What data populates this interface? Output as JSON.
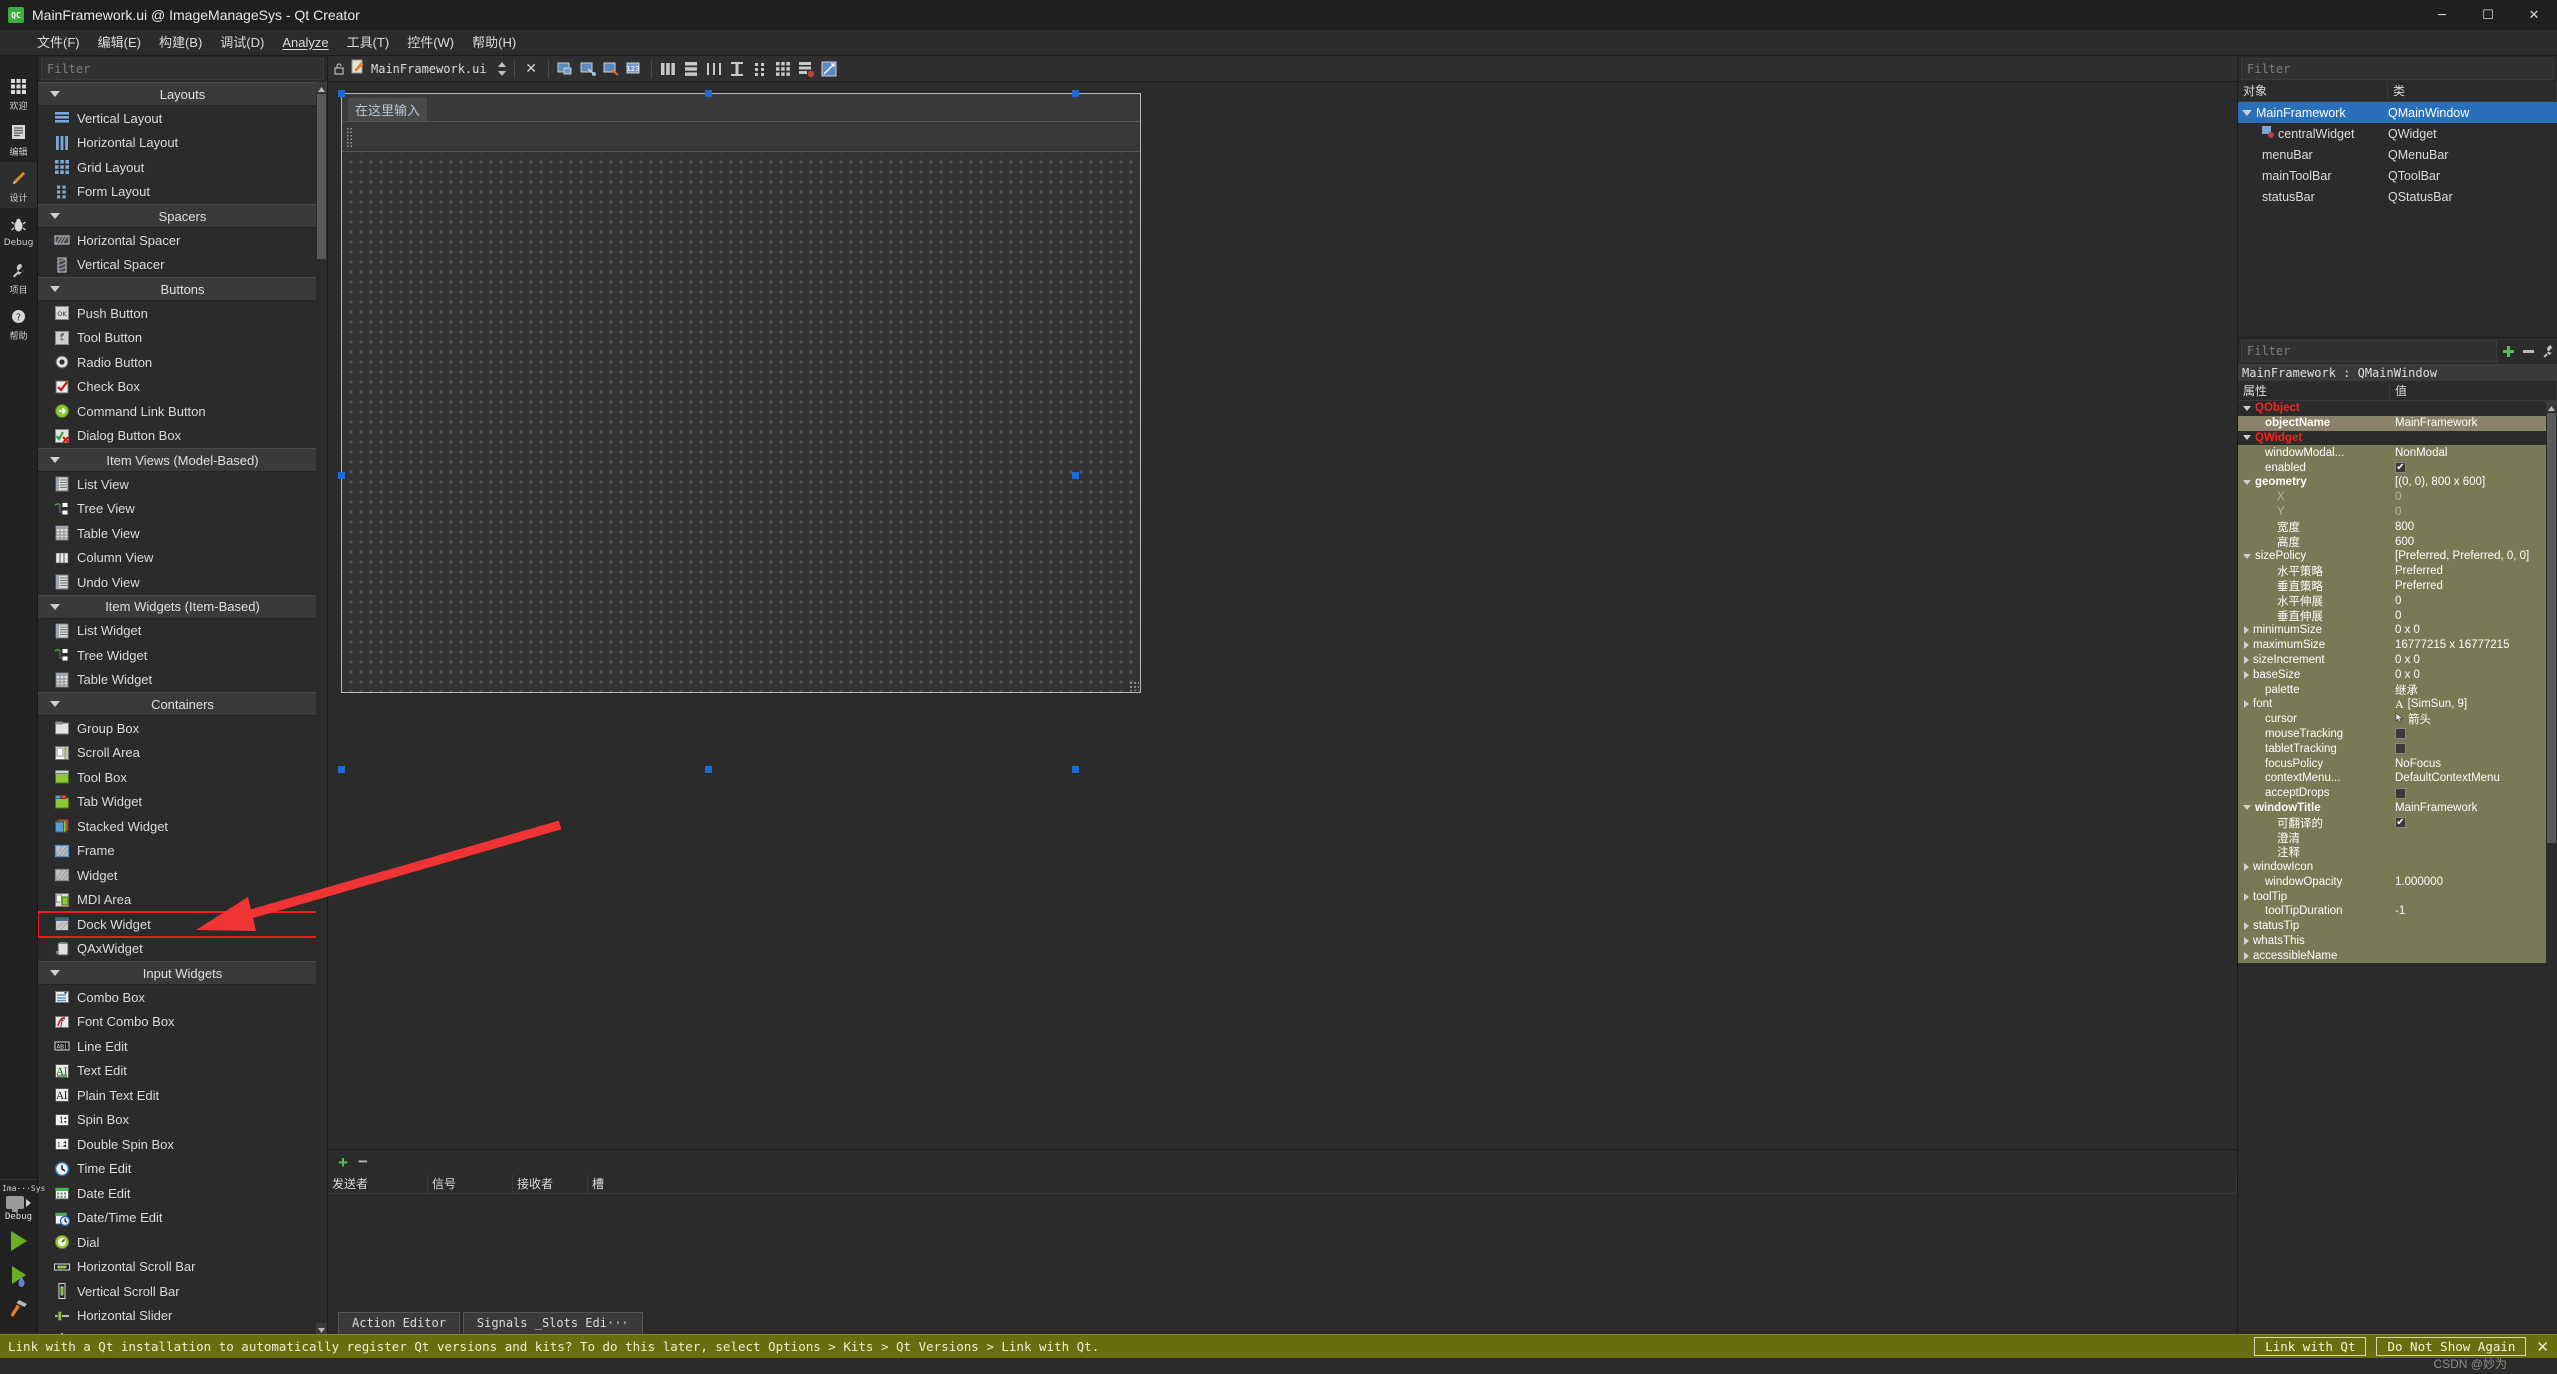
{
  "window": {
    "title": "MainFramework.ui @ ImageManageSys - Qt Creator",
    "app_icon": "QC",
    "minimize": "─",
    "maximize": "☐",
    "close": "✕"
  },
  "menubar": {
    "items": [
      {
        "label": "文件(F)",
        "name": "menu-file"
      },
      {
        "label": "编辑(E)",
        "name": "menu-edit"
      },
      {
        "label": "构建(B)",
        "name": "menu-build"
      },
      {
        "label": "调试(D)",
        "name": "menu-debug"
      },
      {
        "label": "Analyze",
        "name": "menu-analyze"
      },
      {
        "label": "工具(T)",
        "name": "menu-tools"
      },
      {
        "label": "控件(W)",
        "name": "menu-widget"
      },
      {
        "label": "帮助(H)",
        "name": "menu-help"
      }
    ]
  },
  "modebar": {
    "modes": [
      {
        "label": "欢迎",
        "icon": "grid-icon",
        "glyph": "▒",
        "active": false
      },
      {
        "label": "编辑",
        "icon": "document-icon",
        "glyph": "☰",
        "active": false
      },
      {
        "label": "设计",
        "icon": "pencil-icon",
        "glyph": "╱",
        "active": true
      },
      {
        "label": "Debug",
        "icon": "bug-icon",
        "glyph": "✱",
        "active": false
      },
      {
        "label": "项目",
        "icon": "wrench-icon",
        "glyph": "⚒",
        "active": false
      },
      {
        "label": "帮助",
        "icon": "question-icon",
        "glyph": "?",
        "active": false
      }
    ],
    "kit_name": "Ima···Sys",
    "kit_mode": "Debug",
    "run_label": "run",
    "debug_label": "debug",
    "build_label": "build"
  },
  "widgetbox": {
    "filter_placeholder": "Filter",
    "groups": [
      {
        "title": "Layouts",
        "items": [
          {
            "label": "Vertical Layout",
            "icon": "vertical-layout-icon"
          },
          {
            "label": "Horizontal Layout",
            "icon": "horizontal-layout-icon"
          },
          {
            "label": "Grid Layout",
            "icon": "grid-layout-icon"
          },
          {
            "label": "Form Layout",
            "icon": "form-layout-icon"
          }
        ]
      },
      {
        "title": "Spacers",
        "items": [
          {
            "label": "Horizontal Spacer",
            "icon": "horizontal-spacer-icon"
          },
          {
            "label": "Vertical Spacer",
            "icon": "vertical-spacer-icon"
          }
        ]
      },
      {
        "title": "Buttons",
        "items": [
          {
            "label": "Push Button",
            "icon": "push-button-icon"
          },
          {
            "label": "Tool Button",
            "icon": "tool-button-icon"
          },
          {
            "label": "Radio Button",
            "icon": "radio-button-icon"
          },
          {
            "label": "Check Box",
            "icon": "check-box-icon"
          },
          {
            "label": "Command Link Button",
            "icon": "command-link-icon"
          },
          {
            "label": "Dialog Button Box",
            "icon": "dialog-button-box-icon"
          }
        ]
      },
      {
        "title": "Item Views (Model-Based)",
        "items": [
          {
            "label": "List View",
            "icon": "list-view-icon"
          },
          {
            "label": "Tree View",
            "icon": "tree-view-icon"
          },
          {
            "label": "Table View",
            "icon": "table-view-icon"
          },
          {
            "label": "Column View",
            "icon": "column-view-icon"
          },
          {
            "label": "Undo View",
            "icon": "undo-view-icon"
          }
        ]
      },
      {
        "title": "Item Widgets (Item-Based)",
        "items": [
          {
            "label": "List Widget",
            "icon": "list-widget-icon"
          },
          {
            "label": "Tree Widget",
            "icon": "tree-widget-icon"
          },
          {
            "label": "Table Widget",
            "icon": "table-widget-icon"
          }
        ]
      },
      {
        "title": "Containers",
        "items": [
          {
            "label": "Group Box",
            "icon": "group-box-icon"
          },
          {
            "label": "Scroll Area",
            "icon": "scroll-area-icon"
          },
          {
            "label": "Tool Box",
            "icon": "tool-box-icon"
          },
          {
            "label": "Tab Widget",
            "icon": "tab-widget-icon"
          },
          {
            "label": "Stacked Widget",
            "icon": "stacked-widget-icon"
          },
          {
            "label": "Frame",
            "icon": "frame-icon"
          },
          {
            "label": "Widget",
            "icon": "widget-icon"
          },
          {
            "label": "MDI Area",
            "icon": "mdi-area-icon"
          },
          {
            "label": "Dock Widget",
            "icon": "dock-widget-icon",
            "highlight": true
          },
          {
            "label": "QAxWidget",
            "icon": "qax-widget-icon"
          }
        ]
      },
      {
        "title": "Input Widgets",
        "items": [
          {
            "label": "Combo Box",
            "icon": "combo-box-icon"
          },
          {
            "label": "Font Combo Box",
            "icon": "font-combo-box-icon"
          },
          {
            "label": "Line Edit",
            "icon": "line-edit-icon"
          },
          {
            "label": "Text Edit",
            "icon": "text-edit-icon"
          },
          {
            "label": "Plain Text Edit",
            "icon": "plain-text-edit-icon"
          },
          {
            "label": "Spin Box",
            "icon": "spin-box-icon"
          },
          {
            "label": "Double Spin Box",
            "icon": "double-spin-box-icon"
          },
          {
            "label": "Time Edit",
            "icon": "time-edit-icon"
          },
          {
            "label": "Date Edit",
            "icon": "date-edit-icon"
          },
          {
            "label": "Date/Time Edit",
            "icon": "date-time-edit-icon"
          },
          {
            "label": "Dial",
            "icon": "dial-icon"
          },
          {
            "label": "Horizontal Scroll Bar",
            "icon": "horizontal-scroll-bar-icon"
          },
          {
            "label": "Vertical Scroll Bar",
            "icon": "vertical-scroll-bar-icon"
          },
          {
            "label": "Horizontal Slider",
            "icon": "horizontal-slider-icon"
          },
          {
            "label": "Vertical Slider",
            "icon": "vertical-slider-icon"
          }
        ]
      }
    ],
    "highlight_color": "#ee1c1c",
    "annotation_arrow_color": "#f03434"
  },
  "form_toolbar": {
    "filename": "MainFramework.ui",
    "lock_icon": "lock-icon",
    "file_icon": "ui-file-icon",
    "close_icon": "close-icon",
    "buttons": [
      {
        "name": "edit-widgets-button",
        "icon": "edit-widgets-icon"
      },
      {
        "name": "edit-signals-slots-button",
        "icon": "signals-slots-icon"
      },
      {
        "name": "edit-buddies-button",
        "icon": "buddies-icon"
      },
      {
        "name": "edit-tab-order-button",
        "icon": "tab-order-icon"
      },
      {
        "name": "layout-horizontally-button",
        "icon": "layout-horizontal-icon"
      },
      {
        "name": "layout-vertically-button",
        "icon": "layout-vertical-icon"
      },
      {
        "name": "layout-splitter-horizontal-button",
        "icon": "splitter-horizontal-icon"
      },
      {
        "name": "layout-splitter-vertical-button",
        "icon": "splitter-vertical-icon"
      },
      {
        "name": "layout-form-button",
        "icon": "layout-form-icon"
      },
      {
        "name": "layout-grid-button",
        "icon": "layout-grid-icon"
      },
      {
        "name": "break-layout-button",
        "icon": "break-layout-icon"
      },
      {
        "name": "adjust-size-button",
        "icon": "adjust-size-icon"
      }
    ]
  },
  "canvas": {
    "menu_hint": "在这里输入",
    "form_width": 800,
    "form_height": 600
  },
  "bottom_pane": {
    "add_label": "+",
    "remove_label": "−",
    "columns": [
      "发送者",
      "信号",
      "接收者",
      "槽"
    ],
    "rows": [],
    "tabs": [
      {
        "label": "Action Editor",
        "active": false
      },
      {
        "label": "Signals _Slots Edi···",
        "active": true
      }
    ]
  },
  "object_inspector": {
    "filter_placeholder": "Filter",
    "columns": [
      "对象",
      "类"
    ],
    "rows": [
      {
        "name": "MainFramework",
        "class": "QMainWindow",
        "indent": 0,
        "selected": true,
        "expander": true,
        "icon": ""
      },
      {
        "name": "centralWidget",
        "class": "QWidget",
        "indent": 1,
        "selected": false,
        "expander": false,
        "icon": "central-widget-icon"
      },
      {
        "name": "menuBar",
        "class": "QMenuBar",
        "indent": 1,
        "selected": false,
        "expander": false,
        "icon": ""
      },
      {
        "name": "mainToolBar",
        "class": "QToolBar",
        "indent": 1,
        "selected": false,
        "expander": false,
        "icon": ""
      },
      {
        "name": "statusBar",
        "class": "QStatusBar",
        "indent": 1,
        "selected": false,
        "expander": false,
        "icon": ""
      }
    ],
    "selection_color": "#2a6fbb"
  },
  "property_editor": {
    "filter_placeholder": "Filter",
    "object_line": "MainFramework : QMainWindow",
    "columns": [
      "属性",
      "值"
    ],
    "toolbar": [
      {
        "name": "add-dynamic-property-button",
        "icon": "plus-icon",
        "label": "+"
      },
      {
        "name": "remove-dynamic-property-button",
        "icon": "minus-icon",
        "label": "−"
      },
      {
        "name": "configure-button",
        "icon": "wrench-icon",
        "label": "⚒"
      }
    ],
    "rows": [
      {
        "name": "QObject",
        "value": "",
        "style": "group",
        "indent": 0,
        "expander": "down"
      },
      {
        "name": "objectName",
        "value": "MainFramework",
        "style": "tan",
        "indent": 1,
        "bold": true
      },
      {
        "name": "QWidget",
        "value": "",
        "style": "group",
        "indent": 0,
        "expander": "down"
      },
      {
        "name": "windowModal...",
        "value": "NonModal",
        "style": "olive",
        "indent": 1
      },
      {
        "name": "enabled",
        "value": "",
        "style": "olive",
        "indent": 1,
        "checkbox": true,
        "checked": true
      },
      {
        "name": "geometry",
        "value": "[(0, 0), 800 x 600]",
        "style": "olive",
        "indent": 0,
        "expander": "down",
        "bold": true
      },
      {
        "name": "X",
        "value": "0",
        "style": "olive",
        "indent": 2,
        "dim": true
      },
      {
        "name": "Y",
        "value": "0",
        "style": "olive",
        "indent": 2,
        "dim": true
      },
      {
        "name": "宽度",
        "value": "800",
        "style": "olive",
        "indent": 2
      },
      {
        "name": "高度",
        "value": "600",
        "style": "olive",
        "indent": 2
      },
      {
        "name": "sizePolicy",
        "value": "[Preferred, Preferred, 0, 0]",
        "style": "olive",
        "indent": 0,
        "expander": "down"
      },
      {
        "name": "水平策略",
        "value": "Preferred",
        "style": "olive",
        "indent": 2
      },
      {
        "name": "垂直策略",
        "value": "Preferred",
        "style": "olive",
        "indent": 2
      },
      {
        "name": "水平伸展",
        "value": "0",
        "style": "olive",
        "indent": 2
      },
      {
        "name": "垂直伸展",
        "value": "0",
        "style": "olive",
        "indent": 2
      },
      {
        "name": "minimumSize",
        "value": "0 x 0",
        "style": "olive",
        "indent": 0,
        "expander": "right"
      },
      {
        "name": "maximumSize",
        "value": "16777215 x 16777215",
        "style": "olive",
        "indent": 0,
        "expander": "right"
      },
      {
        "name": "sizeIncrement",
        "value": "0 x 0",
        "style": "olive",
        "indent": 0,
        "expander": "right"
      },
      {
        "name": "baseSize",
        "value": "0 x 0",
        "style": "olive",
        "indent": 0,
        "expander": "right"
      },
      {
        "name": "palette",
        "value": "继承",
        "style": "olive",
        "indent": 1
      },
      {
        "name": "font",
        "value": "[SimSun, 9]",
        "style": "olive",
        "indent": 0,
        "expander": "right",
        "valicon": "font-icon"
      },
      {
        "name": "cursor",
        "value": "箭头",
        "style": "olive",
        "indent": 1,
        "valicon": "cursor-icon"
      },
      {
        "name": "mouseTracking",
        "value": "",
        "style": "olive",
        "indent": 1,
        "checkbox": true,
        "checked": false
      },
      {
        "name": "tabletTracking",
        "value": "",
        "style": "olive",
        "indent": 1,
        "checkbox": true,
        "checked": false
      },
      {
        "name": "focusPolicy",
        "value": "NoFocus",
        "style": "olive",
        "indent": 1
      },
      {
        "name": "contextMenu...",
        "value": "DefaultContextMenu",
        "style": "olive",
        "indent": 1
      },
      {
        "name": "acceptDrops",
        "value": "",
        "style": "olive",
        "indent": 1,
        "checkbox": true,
        "checked": false
      },
      {
        "name": "windowTitle",
        "value": "MainFramework",
        "style": "olive",
        "indent": 0,
        "expander": "down",
        "bold": true
      },
      {
        "name": "可翻译的",
        "value": "",
        "style": "olive",
        "indent": 2,
        "checkbox": true,
        "checked": true
      },
      {
        "name": "澄清",
        "value": "",
        "style": "olive",
        "indent": 2
      },
      {
        "name": "注释",
        "value": "",
        "style": "olive",
        "indent": 2
      },
      {
        "name": "windowIcon",
        "value": "",
        "style": "olive",
        "indent": 0,
        "expander": "right"
      },
      {
        "name": "windowOpacity",
        "value": "1.000000",
        "style": "olive",
        "indent": 1
      },
      {
        "name": "toolTip",
        "value": "",
        "style": "olive",
        "indent": 0,
        "expander": "right"
      },
      {
        "name": "toolTipDuration",
        "value": "-1",
        "style": "olive",
        "indent": 1
      },
      {
        "name": "statusTip",
        "value": "",
        "style": "olive",
        "indent": 0,
        "expander": "right"
      },
      {
        "name": "whatsThis",
        "value": "",
        "style": "olive",
        "indent": 0,
        "expander": "right"
      },
      {
        "name": "accessibleName",
        "value": "",
        "style": "olive",
        "indent": 0,
        "expander": "right"
      }
    ]
  },
  "notification": {
    "message": "Link with a Qt installation to automatically register Qt versions and kits? To do this later, select Options > Kits > Qt Versions > Link with Qt.",
    "primary_button": "Link with Qt",
    "secondary_button": "Do Not Show Again",
    "close_icon": "close-icon",
    "background": "#6b6b0f",
    "watermark": "CSDN @妙为"
  }
}
